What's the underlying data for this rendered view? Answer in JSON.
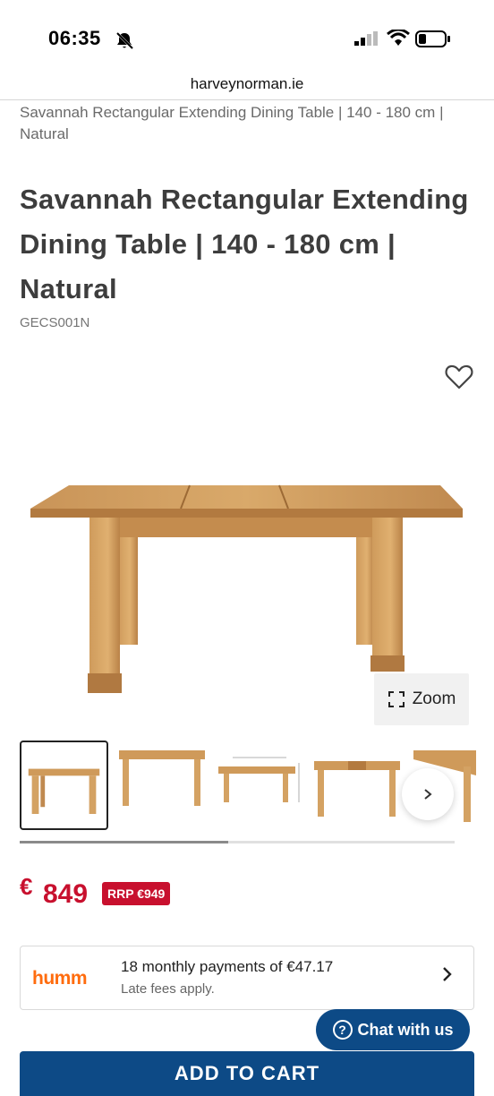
{
  "status_bar": {
    "time": "06:35"
  },
  "browser": {
    "url": "harveynorman.ie"
  },
  "breadcrumb": "Savannah Rectangular Extending Dining Table | 140 - 180 cm | Natural",
  "product": {
    "title": "Savannah Rectangular Extending Dining Table | 140 - 180 cm | Natural",
    "sku": "GECS001N",
    "zoom_label": "Zoom",
    "gallery_progress": 0.48,
    "price_currency": "€",
    "price_amount": "849",
    "rrp": "RRP €949"
  },
  "humm": {
    "logo": "humm",
    "main": "18 monthly payments of €47.17",
    "sub": "Late fees apply."
  },
  "chat": {
    "label": "Chat with us"
  },
  "cart": {
    "label": "ADD TO CART"
  },
  "colors": {
    "accent_red": "#c8102e",
    "primary_blue": "#0d4a86",
    "humm_orange": "#ff6c0e"
  }
}
